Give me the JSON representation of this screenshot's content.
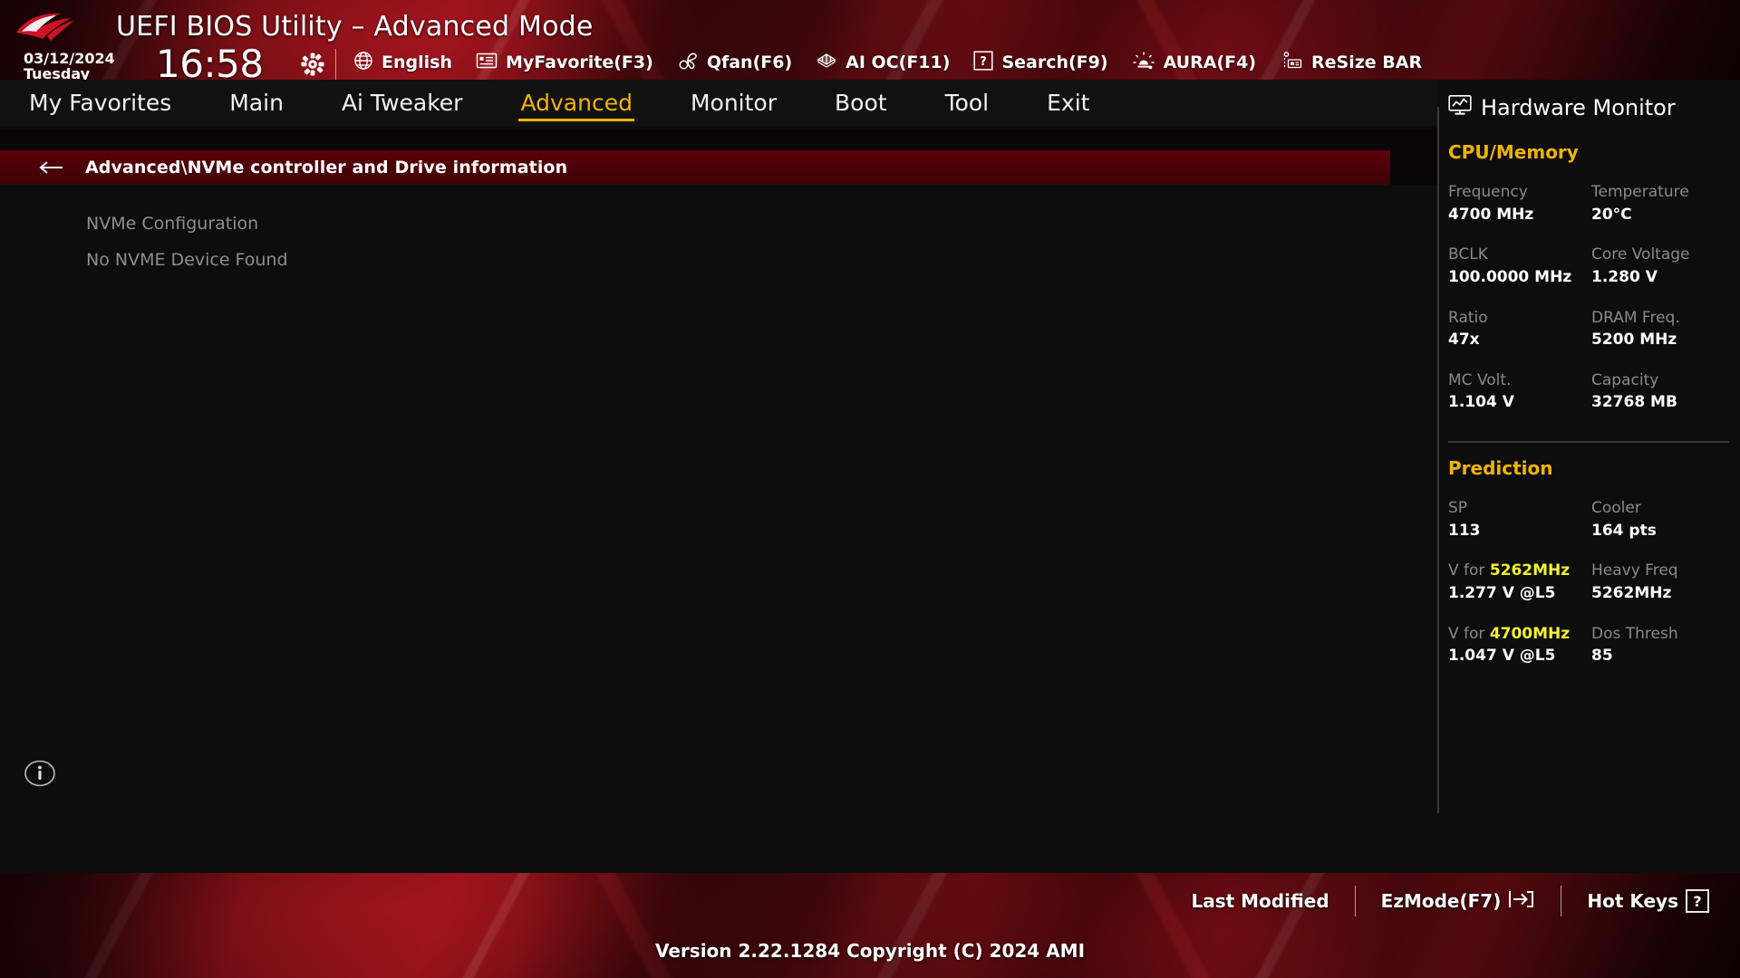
{
  "header": {
    "title": "UEFI BIOS Utility – Advanced Mode",
    "logo_icon": "rog-logo-icon",
    "date": "03/12/2024",
    "weekday": "Tuesday",
    "time": "16:58",
    "gear_icon": "gear-icon",
    "toolbar": [
      {
        "label": "English",
        "icon": "globe-icon"
      },
      {
        "label": "MyFavorite(F3)",
        "icon": "favorites-list-icon"
      },
      {
        "label": "Qfan(F6)",
        "icon": "fan-icon"
      },
      {
        "label": "AI OC(F11)",
        "icon": "ai-oc-icon"
      },
      {
        "label": "Search(F9)",
        "icon": "question-box-icon"
      },
      {
        "label": "AURA(F4)",
        "icon": "aura-light-icon"
      },
      {
        "label": "ReSize BAR",
        "icon": "resize-bar-icon"
      }
    ]
  },
  "tabs": [
    {
      "label": "My Favorites",
      "active": false
    },
    {
      "label": "Main",
      "active": false
    },
    {
      "label": "Ai Tweaker",
      "active": false
    },
    {
      "label": "Advanced",
      "active": true
    },
    {
      "label": "Monitor",
      "active": false
    },
    {
      "label": "Boot",
      "active": false
    },
    {
      "label": "Tool",
      "active": false
    },
    {
      "label": "Exit",
      "active": false
    }
  ],
  "breadcrumb": {
    "back_icon": "back-arrow-icon",
    "path": "Advanced\\NVMe controller and Drive information"
  },
  "content": {
    "rows": [
      {
        "label": "NVMe Configuration"
      },
      {
        "label": "No NVME Device Found"
      }
    ],
    "info_icon": "info-circle-icon"
  },
  "hardware_monitor": {
    "title": "Hardware Monitor",
    "title_icon": "monitor-graph-icon",
    "sections": [
      {
        "name": "CPU/Memory",
        "pairs": [
          {
            "k1": "Frequency",
            "v1": "4700 MHz",
            "k2": "Temperature",
            "v2": "20°C"
          },
          {
            "k1": "BCLK",
            "v1": "100.0000 MHz",
            "k2": "Core Voltage",
            "v2": "1.280 V"
          },
          {
            "k1": "Ratio",
            "v1": "47x",
            "k2": "DRAM Freq.",
            "v2": "5200 MHz"
          },
          {
            "k1": "MC Volt.",
            "v1": "1.104 V",
            "k2": "Capacity",
            "v2": "32768 MB"
          }
        ]
      },
      {
        "name": "Prediction",
        "pairs": [
          {
            "k1": "SP",
            "v1": "113",
            "k2": "Cooler",
            "v2": "164 pts"
          },
          {
            "k1": "V for ",
            "k1_hl": "5262MHz",
            "v1": "1.277 V @L5",
            "k2": "Heavy Freq",
            "v2": "5262MHz"
          },
          {
            "k1": "V for ",
            "k1_hl": "4700MHz",
            "v1": "1.047 V @L5",
            "k2": "Dos Thresh",
            "v2": "85"
          }
        ]
      }
    ]
  },
  "footer": {
    "last_modified": "Last Modified",
    "ezmode": "EzMode(F7)",
    "ezmode_icon": "exit-arrow-icon",
    "hotkeys": "Hot Keys",
    "hotkeys_icon": "question-box-icon",
    "version": "Version 2.22.1284 Copyright (C) 2024 AMI"
  },
  "colors": {
    "accent_yellow": "#f0b400",
    "highlight_yellow": "#f3f32a",
    "crumb_red": "#4a0207",
    "panel_bg": "#0d0d0d"
  }
}
